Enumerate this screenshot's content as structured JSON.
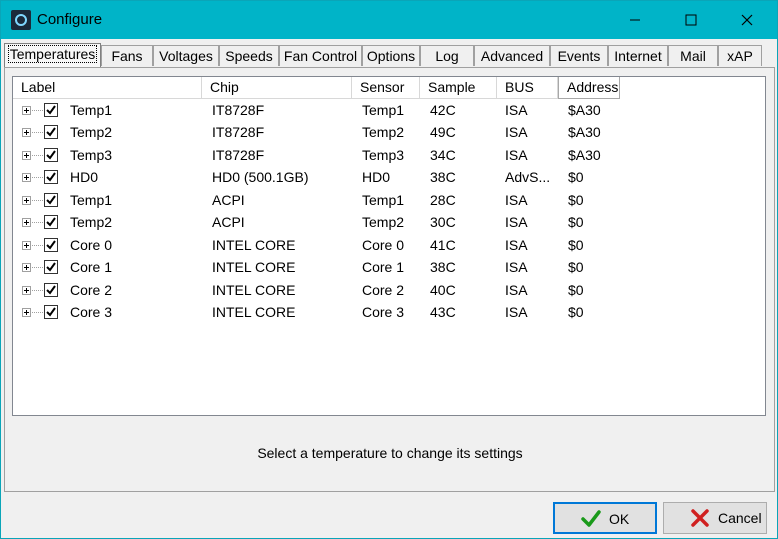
{
  "window": {
    "title": "Configure"
  },
  "tabs": [
    "Temperatures",
    "Fans",
    "Voltages",
    "Speeds",
    "Fan Control",
    "Options",
    "Log",
    "Advanced",
    "Events",
    "Internet",
    "Mail",
    "xAP"
  ],
  "columns": [
    "Label",
    "Chip",
    "Sensor",
    "Sample",
    "BUS",
    "Address"
  ],
  "rows": [
    {
      "label": "Temp1",
      "chip": "IT8728F",
      "sensor": "Temp1",
      "sample": "42C",
      "bus": "ISA",
      "address": "$A30"
    },
    {
      "label": "Temp2",
      "chip": "IT8728F",
      "sensor": "Temp2",
      "sample": "49C",
      "bus": "ISA",
      "address": "$A30"
    },
    {
      "label": "Temp3",
      "chip": "IT8728F",
      "sensor": "Temp3",
      "sample": "34C",
      "bus": "ISA",
      "address": "$A30"
    },
    {
      "label": "HD0",
      "chip": "HD0 (500.1GB)",
      "sensor": "HD0",
      "sample": "38C",
      "bus": "AdvS...",
      "address": "$0"
    },
    {
      "label": "Temp1",
      "chip": "ACPI",
      "sensor": "Temp1",
      "sample": "28C",
      "bus": "ISA",
      "address": "$0"
    },
    {
      "label": "Temp2",
      "chip": "ACPI",
      "sensor": "Temp2",
      "sample": "30C",
      "bus": "ISA",
      "address": "$0"
    },
    {
      "label": "Core 0",
      "chip": "INTEL CORE",
      "sensor": "Core 0",
      "sample": "41C",
      "bus": "ISA",
      "address": "$0"
    },
    {
      "label": "Core 1",
      "chip": "INTEL CORE",
      "sensor": "Core 1",
      "sample": "38C",
      "bus": "ISA",
      "address": "$0"
    },
    {
      "label": "Core 2",
      "chip": "INTEL CORE",
      "sensor": "Core 2",
      "sample": "40C",
      "bus": "ISA",
      "address": "$0"
    },
    {
      "label": "Core 3",
      "chip": "INTEL CORE",
      "sensor": "Core 3",
      "sample": "43C",
      "bus": "ISA",
      "address": "$0"
    }
  ],
  "hint": "Select a temperature to change its settings",
  "buttons": {
    "ok": "OK",
    "cancel": "Cancel"
  },
  "colors": {
    "titlebar": "#00b4c8",
    "ok_check": "#1a9a1a",
    "cancel_x": "#d02020",
    "focus_border": "#0078d7"
  }
}
